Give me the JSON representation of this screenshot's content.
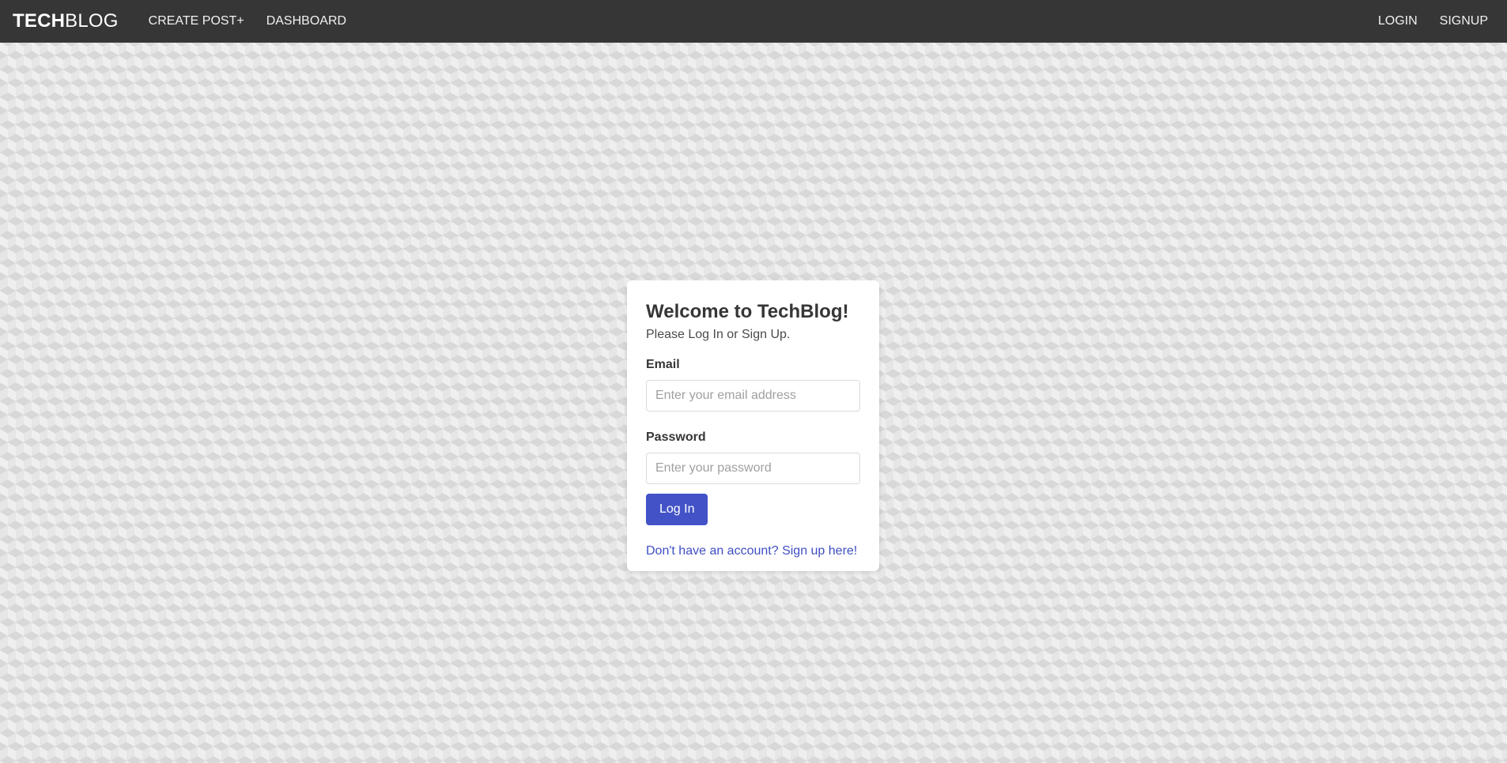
{
  "navbar": {
    "brand_bold": "TECH",
    "brand_light": "BLOG",
    "links_left": [
      {
        "label": "CREATE POST+"
      },
      {
        "label": "DASHBOARD"
      }
    ],
    "links_right": [
      {
        "label": "LOGIN"
      },
      {
        "label": "SIGNUP"
      }
    ]
  },
  "login_card": {
    "title": "Welcome to TechBlog!",
    "subtitle": "Please Log In or Sign Up.",
    "email": {
      "label": "Email",
      "value": "",
      "placeholder": "Enter your email address"
    },
    "password": {
      "label": "Password",
      "value": "",
      "placeholder": "Enter your password"
    },
    "submit_label": "Log In",
    "signup_link": "Don't have an account? Sign up here!"
  },
  "colors": {
    "navbar_bg": "#363636",
    "primary_button": "#4353c7",
    "link": "#3f4fc4"
  }
}
